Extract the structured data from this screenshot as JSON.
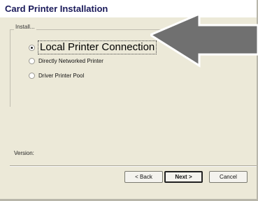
{
  "window": {
    "title": "Card Printer Installation"
  },
  "install_group": {
    "legend": "Install...",
    "options": [
      {
        "label": "Local Printer Connection",
        "selected": true
      },
      {
        "label": "Directly Networked Printer",
        "selected": false
      },
      {
        "label": "Driver Printer Pool",
        "selected": false
      }
    ]
  },
  "version_label": "Version:",
  "buttons": {
    "back": "< Back",
    "next": "Next >",
    "cancel": "Cancel"
  },
  "annotation": {
    "arrow_color": "#707070"
  }
}
